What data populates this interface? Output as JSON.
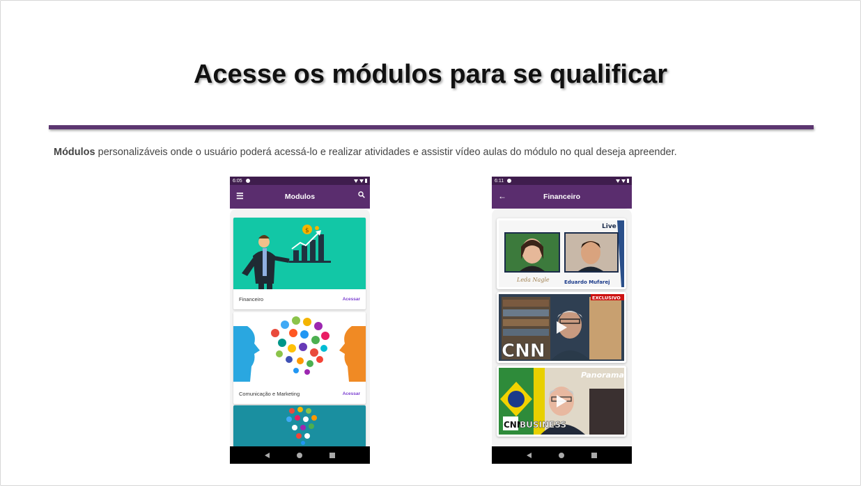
{
  "slide": {
    "title": "Acesse os módulos para se qualificar",
    "description_bold": "Módulos",
    "description_rest": " personalizáveis onde o usuário poderá acessá-lo e realizar atividades e assistir vídeo aulas do módulo no qual deseja apreender.",
    "accent_color": "#5c3670"
  },
  "phone_left": {
    "status_time": "6:05",
    "appbar_title": "Modulos",
    "menu_icon": "hamburger-menu-icon",
    "search_icon": "search-icon",
    "cards": [
      {
        "label": "Financeiro",
        "action": "Acessar"
      },
      {
        "label": "Comunicação e Marketing",
        "action": "Acessar"
      }
    ]
  },
  "phone_right": {
    "status_time": "6:11",
    "appbar_title": "Financeiro",
    "back_icon": "arrow-back-icon",
    "videos": [
      {
        "badge": "Live",
        "name_left": "Leda Nagle",
        "name_right": "Eduardo Mufarej"
      },
      {
        "badge": "EXCLUSIVO",
        "brand": "CNN"
      },
      {
        "badge": "Panorama",
        "brand": "CNN",
        "brand_sub": "BUSINESS"
      }
    ]
  }
}
